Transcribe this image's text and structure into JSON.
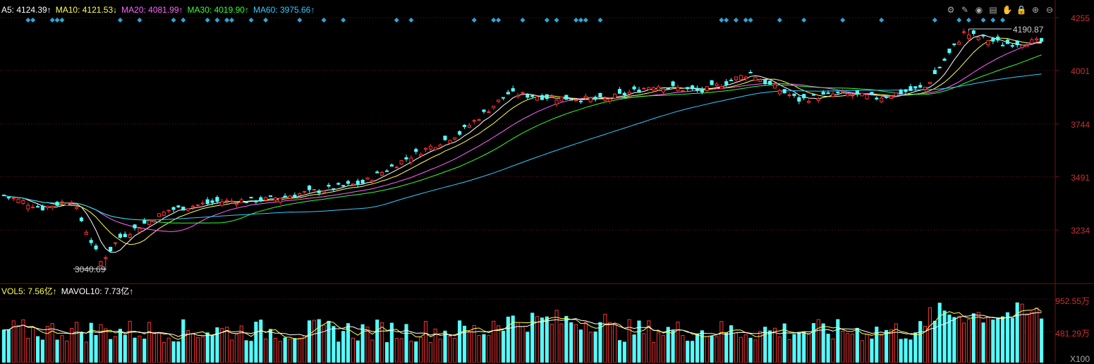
{
  "legend_main": [
    {
      "text": "A5: 4124.39↑",
      "color": "#ffffff"
    },
    {
      "text": "MA10: 4121.53↓",
      "color": "#ffff4d"
    },
    {
      "text": "MA20: 4081.99↑",
      "color": "#ff66ff"
    },
    {
      "text": "MA30: 4019.90↑",
      "color": "#33ff33"
    },
    {
      "text": "MA60: 3975.66↑",
      "color": "#33ccff"
    }
  ],
  "legend_vol": [
    {
      "text": "VOL5: 7.56亿↑",
      "color": "#ffff4d"
    },
    {
      "text": "MAVOL10: 7.73亿↑",
      "color": "#ffffff"
    }
  ],
  "annotations": {
    "high": "4190.87",
    "low": "3040.69"
  },
  "vol_unit": "X100",
  "toolbar": [
    "gear-icon",
    "brush-icon",
    "eye-icon",
    "trash-icon",
    "hand-icon",
    "lock-icon",
    "zoom-in-icon",
    "zoom-out-icon"
  ],
  "colors": {
    "up": "#ff3232",
    "down": "#54ffff",
    "grid": "#7a1010",
    "ma5": "#ffffff",
    "ma10": "#ffff4d",
    "ma20": "#ff66ff",
    "ma30": "#33ff33",
    "ma60": "#33ccff",
    "marker": "#2aa8d8"
  },
  "chart_data": {
    "type": "candlestick",
    "y_ticks": [
      4255,
      4001,
      3744,
      3491,
      3234
    ],
    "ylim": [
      3040,
      4255
    ],
    "vol_ticks": [
      "952.55万",
      "481.29万"
    ],
    "vol_max": 952.55,
    "ohlc_keypoints": [
      [
        0,
        3400
      ],
      [
        8,
        3340
      ],
      [
        14,
        3380
      ],
      [
        20,
        3080
      ],
      [
        24,
        3200
      ],
      [
        34,
        3330
      ],
      [
        44,
        3370
      ],
      [
        54,
        3380
      ],
      [
        64,
        3420
      ],
      [
        74,
        3460
      ],
      [
        84,
        3590
      ],
      [
        94,
        3700
      ],
      [
        104,
        3890
      ],
      [
        114,
        3870
      ],
      [
        124,
        3860
      ],
      [
        134,
        3930
      ],
      [
        144,
        3900
      ],
      [
        154,
        3990
      ],
      [
        158,
        3930
      ],
      [
        164,
        3860
      ],
      [
        172,
        3890
      ],
      [
        180,
        3870
      ],
      [
        190,
        3920
      ],
      [
        198,
        4180
      ],
      [
        206,
        4130
      ],
      [
        214,
        4140
      ]
    ],
    "bar_count": 215
  }
}
